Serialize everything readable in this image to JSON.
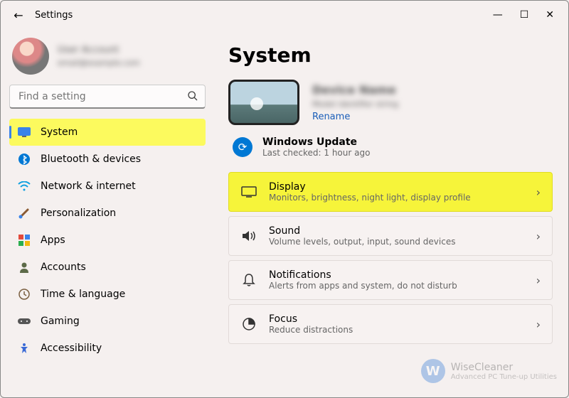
{
  "window": {
    "title": "Settings",
    "back": "←",
    "minimize": "—",
    "maximize": "☐",
    "close": "✕"
  },
  "profile": {
    "name": "User Account",
    "email": "email@example.com"
  },
  "search": {
    "placeholder": "Find a setting"
  },
  "sidebar": {
    "items": [
      {
        "label": "System"
      },
      {
        "label": "Bluetooth & devices"
      },
      {
        "label": "Network & internet"
      },
      {
        "label": "Personalization"
      },
      {
        "label": "Apps"
      },
      {
        "label": "Accounts"
      },
      {
        "label": "Time & language"
      },
      {
        "label": "Gaming"
      },
      {
        "label": "Accessibility"
      }
    ]
  },
  "page": {
    "heading": "System",
    "device_name": "Device Name",
    "device_model": "Model identifier string",
    "rename": "Rename",
    "update": {
      "title": "Windows Update",
      "subtitle": "Last checked: 1 hour ago"
    },
    "cards": [
      {
        "title": "Display",
        "subtitle": "Monitors, brightness, night light, display profile"
      },
      {
        "title": "Sound",
        "subtitle": "Volume levels, output, input, sound devices"
      },
      {
        "title": "Notifications",
        "subtitle": "Alerts from apps and system, do not disturb"
      },
      {
        "title": "Focus",
        "subtitle": "Reduce distractions"
      }
    ]
  },
  "watermark": {
    "brand": "WiseCleaner",
    "sub": "Advanced PC Tune-up Utilities",
    "initial": "W"
  }
}
